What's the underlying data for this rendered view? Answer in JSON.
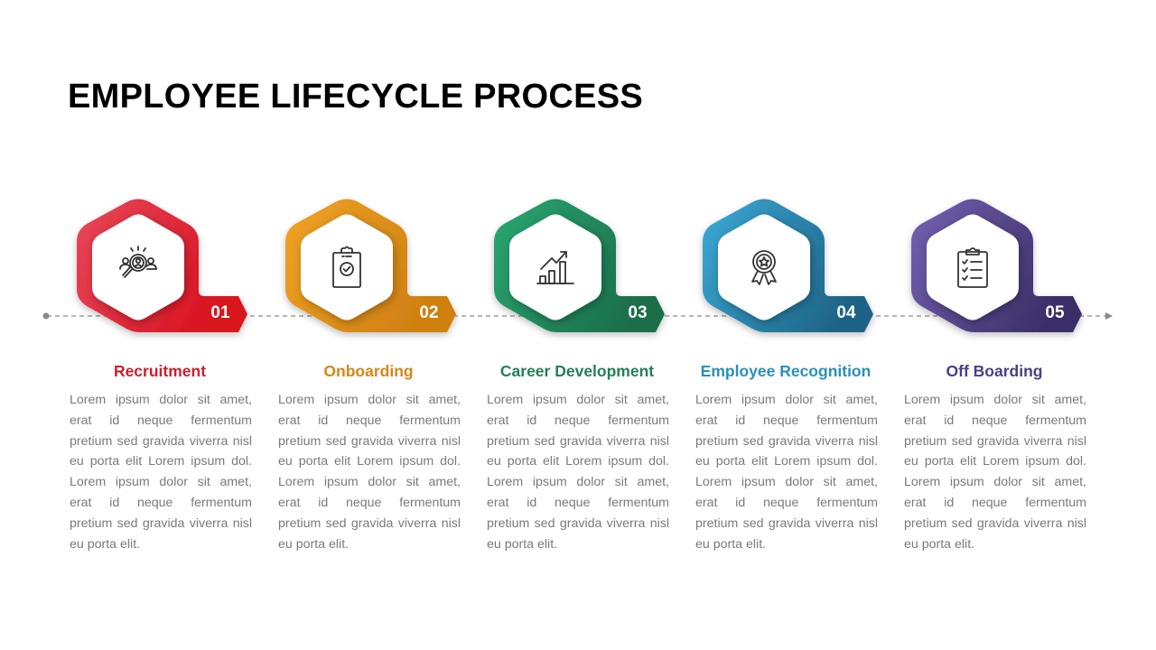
{
  "title": "EMPLOYEE LIFECYCLE PROCESS",
  "steps": [
    {
      "number": "01",
      "heading": "Recruitment",
      "icon": "recruitment-search-people-icon",
      "color_light": "#e8475a",
      "color_dark": "#d9121f",
      "heading_color": "#cc1f2b",
      "description": "Lorem ipsum dolor sit amet, erat id neque fermentum pretium sed gravida viverra nisl eu porta elit Lorem ipsum dol. Lorem ipsum dolor sit amet, erat id neque fermentum pretium sed gravida viverra nisl eu porta elit."
    },
    {
      "number": "02",
      "heading": "Onboarding",
      "icon": "clipboard-check-icon",
      "color_light": "#f0a326",
      "color_dark": "#cf8010",
      "heading_color": "#d4861a",
      "description": "Lorem ipsum dolor sit amet, erat id neque fermentum pretium sed gravida viverra nisl eu porta elit Lorem ipsum dol. Lorem ipsum dolor sit amet, erat id neque fermentum pretium sed gravida viverra nisl eu porta elit."
    },
    {
      "number": "03",
      "heading": "Career Development",
      "icon": "growth-chart-icon",
      "color_light": "#2aa872",
      "color_dark": "#1b6e4a",
      "heading_color": "#237f58",
      "description": "Lorem ipsum dolor sit amet, erat id neque fermentum pretium sed gravida viverra nisl eu porta elit Lorem ipsum dol. Lorem ipsum dolor sit amet, erat id neque fermentum pretium sed gravida viverra nisl eu porta elit."
    },
    {
      "number": "04",
      "heading": "Employee Recognition",
      "icon": "award-ribbon-icon",
      "color_light": "#3aaad6",
      "color_dark": "#1e6487",
      "heading_color": "#2a8fba",
      "description": "Lorem ipsum dolor sit amet, erat id neque fermentum pretium sed gravida viverra nisl eu porta elit Lorem ipsum dol. Lorem ipsum dolor sit amet, erat id neque fermentum pretium sed gravida viverra nisl eu porta elit."
    },
    {
      "number": "05",
      "heading": "Off Boarding",
      "icon": "checklist-clipboard-icon",
      "color_light": "#7561b3",
      "color_dark": "#3b2f67",
      "heading_color": "#4a3e86",
      "description": "Lorem ipsum dolor sit amet, erat id neque fermentum pretium sed gravida viverra nisl eu porta elit Lorem ipsum dol. Lorem ipsum dolor sit amet, erat id neque fermentum pretium sed gravida viverra nisl eu porta elit."
    }
  ],
  "timeline_color": "#8a8a8a"
}
